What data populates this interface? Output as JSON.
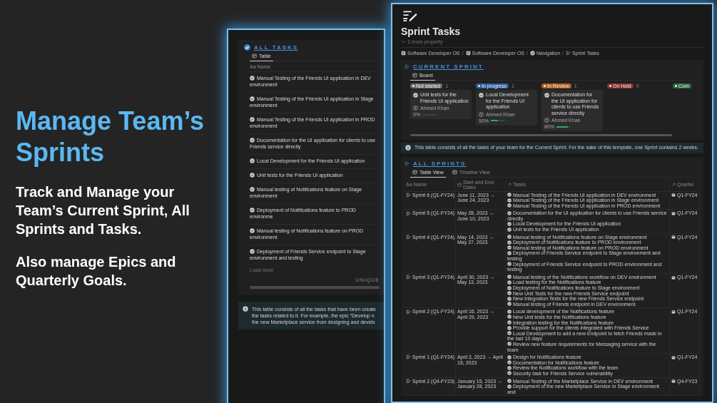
{
  "promo": {
    "heading": "Manage Team’s Sprints",
    "paragraphs": [
      "Track and Manage your Team’s Current Sprint, All Sprints and Tasks.",
      "Also manage Epics and Quarterly Goals."
    ]
  },
  "back_window": {
    "section_title": "ALL TASKS",
    "tabs": [
      {
        "label": "Table",
        "selected": true
      }
    ],
    "column": "Aa Name",
    "rows": [
      {
        "name": "Manual Testing of the Friends UI application in DEV environment",
        "done": true
      },
      {
        "name": "Manual Testing of the Friends UI application in Stage environment",
        "done": true
      },
      {
        "name": "Manual Testing of the Friends UI application in PROD environment",
        "done": true
      },
      {
        "name": "Documentation for the UI application for clients to use Friends service directly",
        "done": true
      },
      {
        "name": "Local Development for the Friends UI application",
        "done": true
      },
      {
        "name": "Unit tests for the Friends UI application",
        "done": true
      },
      {
        "name": "Manual testing of Notifications feature on Stage environment",
        "done": true
      },
      {
        "name": "Deployment of Notifications feature to PROD environme",
        "done": true
      },
      {
        "name": "Manual testing of Notifications feature on PROD environment",
        "done": true
      },
      {
        "name": "Deployment of Friends Service endpoint to Stage environment and testing",
        "done": true
      }
    ],
    "load_more": "Load more",
    "footer_label": "UNIQUE",
    "callout": {
      "lines": [
        "This table consists of all the tasks that have been create",
        "the tasks related to it. For example, the epic “Develop n",
        "the new Marketplace service from designing and develo"
      ]
    }
  },
  "front_window": {
    "title": "Sprint Tasks",
    "more_property": "1 more property",
    "breadcrumb": [
      {
        "label": "Software Developer OS",
        "kind": "page"
      },
      {
        "label": "Software Developer OS",
        "kind": "page"
      },
      {
        "label": "Navigation",
        "kind": "check"
      },
      {
        "label": "Sprint Tasks",
        "kind": "tasks"
      }
    ],
    "separator": "/",
    "current_sprint": {
      "title": "CURRENT SPRINT",
      "tabs": [
        {
          "label": "Board",
          "selected": true
        }
      ],
      "columns": [
        {
          "status": "Not started",
          "color": "#6b6b6b",
          "count": "1",
          "cards": [
            {
              "title": "Unit tests for the Friends UI application",
              "assignee": "Ahmed Khan",
              "progress": "0%",
              "level": 0
            }
          ]
        },
        {
          "status": "In progress",
          "color": "#2f5c9e",
          "count": "1",
          "cards": [
            {
              "title": "Local Development for the Friends UI application",
              "assignee": "Ahmed Khan",
              "progress": "50%",
              "level": 0.5
            }
          ]
        },
        {
          "status": "In Review",
          "color": "#b35a1a",
          "count": "1",
          "cards": [
            {
              "title": "Documentation for the UI application for clients to use Friends service directly",
              "assignee": "Ahmed Khan",
              "progress": "80%",
              "level": 0.8
            }
          ]
        },
        {
          "status": "On Hold",
          "color": "#8e2f2f",
          "count": "0"
        },
        {
          "status": "Com",
          "color": "#2b6b3e"
        }
      ]
    },
    "current_callout": "This table consists of all the tasks of your team for the Current Sprint. For the sake of this template, one Sprint contains 2 weeks.",
    "all_sprints": {
      "title": "ALL SPRINTS",
      "tabs": [
        {
          "label": "Table View",
          "selected": true
        },
        {
          "label": "Timeline View",
          "selected": false
        }
      ],
      "columns": [
        "Aa Name",
        "Start and End Dates",
        "Tasks",
        "Quarter"
      ],
      "rows": [
        {
          "name": "Sprint 6 (Q1-FY24)",
          "dates": "June 11, 2023 → June 24, 2023",
          "quarter": "Q1-FY24",
          "tasks": [
            "Manual Testing of the Friends UI application in DEV environment",
            "Manual Testing of the Friends UI application in Stage environment",
            "Manual Testing of the Friends UI application in PROD environment"
          ]
        },
        {
          "name": "Sprint 5 (Q1-FY24)",
          "dates": "May 28, 2023 → June 10, 2023",
          "quarter": "Q1-FY24",
          "tasks": [
            "Documentation for the UI application for clients to use Friends service directly",
            "Local Development for the Friends UI application",
            "Unit tests for the Friends UI application"
          ]
        },
        {
          "name": "Sprint 4 (Q1-FY24)",
          "dates": "May 14, 2023 → May 27, 2023",
          "quarter": "Q1-FY24",
          "tasks": [
            "Manual testing of Notifications feature on Stage environment",
            "Deployment of Notifications feature to PROD environment",
            "Manual testing of Notifications feature on PROD environment",
            "Deployment of Friends Service endpoint to Stage environment and testing",
            "Deployment of Friends Service endpoint to PROD environment and testing"
          ]
        },
        {
          "name": "Sprint 3 (Q1-FY24)",
          "dates": "April 30, 2023 → May 13, 2023",
          "quarter": "Q1-FY24",
          "tasks": [
            "Manual testing of the Notifications workflow on DEV environment",
            "Load testing for the Notifications feature",
            "Deployment of Notifications feature to Stage environment",
            "New Unit Tests for the new Friends Service endpoint",
            "New Integration Tests for the new Friends Service endpoint",
            "Manual testing of Friends endpoint in DEV environment"
          ]
        },
        {
          "name": "Sprint 2 (Q1-FY24)",
          "dates": "April 16, 2023 → April 29, 2023",
          "quarter": "Q1-FY24",
          "tasks": [
            "Local development of the Notifications feature",
            "New Unit tests for the Notifications feature",
            "Integration testing for the Notifications feature",
            "Provide support for the clients integrated with Friends Service",
            "Local Development to add a new Endpoint to fetch Friends made in the last 10 days",
            "Review new feature requirements for Messaging service with the team"
          ]
        },
        {
          "name": "Sprint 1 (Q1-FY24)",
          "dates": "April 2, 2023 → April 15, 2023",
          "quarter": "Q1-FY24",
          "tasks": [
            "Design for Notifications feature",
            "Documentation for Notifications feature",
            "Review the Notifications workflow with the team",
            "Security task for Friends Service vulnerability"
          ]
        },
        {
          "name": "Sprint 2 (Q4-FY23)",
          "dates": "January 15, 2023 → January 28, 2023",
          "quarter": "Q4-FY23",
          "tasks": [
            "Manual Testing of the Marketplace Service in DEV environment",
            "Deployment of the new Marketplace Service in Stage environment and"
          ]
        }
      ]
    }
  }
}
